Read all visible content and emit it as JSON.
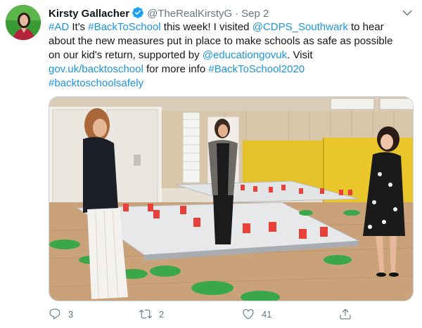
{
  "tweet": {
    "author": {
      "display_name": "Kirsty Gallacher",
      "handle": "@TheRealKirstyG",
      "verified": true
    },
    "separator": "·",
    "date": "Sep 2",
    "text_lines": [
      [
        {
          "t": "#AD",
          "link": true
        },
        {
          "t": " It's ",
          "link": false
        },
        {
          "t": "#BackToSchool",
          "link": true
        },
        {
          "t": " this week! I visited ",
          "link": false
        },
        {
          "t": "@CDPS_Southwark",
          "link": true
        },
        {
          "t": "  to hear",
          "link": false
        }
      ],
      [
        {
          "t": "about the new measures  put in place to make schools as safe as possible",
          "link": false
        }
      ],
      [
        {
          "t": "on our kid's return, supported by ",
          "link": false
        },
        {
          "t": "@educationgovuk",
          "link": true
        },
        {
          "t": ". Visit",
          "link": false
        }
      ],
      [
        {
          "t": "gov.uk/backtoschool",
          "link": true
        },
        {
          "t": " for more info ",
          "link": false
        },
        {
          "t": "#BackToSchool2020",
          "link": true
        }
      ],
      [
        {
          "t": "#backtoschoolsafely",
          "link": true
        }
      ]
    ],
    "media": {
      "icon": "photo",
      "alt": ""
    },
    "actions": {
      "reply_count": "3",
      "retweet_count": "2",
      "like_count": "41"
    },
    "colors": {
      "link": "#1b95e0",
      "secondary_text": "#657786",
      "verified": "#1da1f2"
    }
  }
}
